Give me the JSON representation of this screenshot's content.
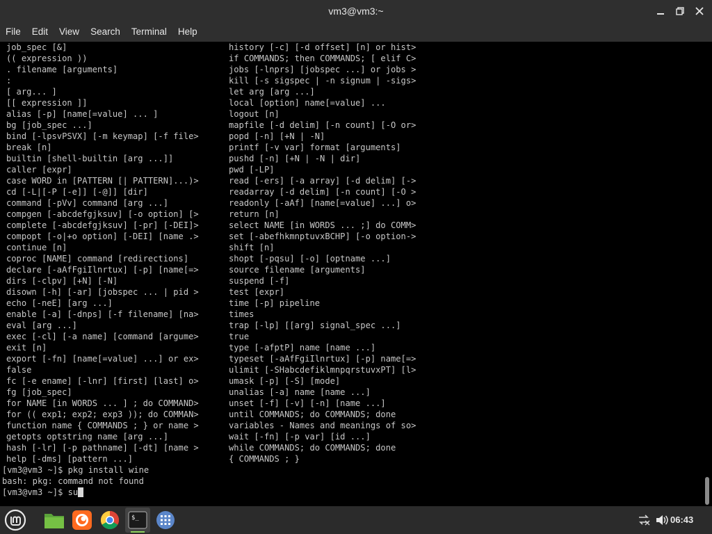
{
  "window": {
    "title": "vm3@vm3:~"
  },
  "menu": {
    "items": [
      "File",
      "Edit",
      "View",
      "Search",
      "Terminal",
      "Help"
    ]
  },
  "terminal": {
    "left_column": [
      "job_spec [&]",
      "(( expression ))",
      ". filename [arguments]",
      ":",
      "[ arg... ]",
      "[[ expression ]]",
      "alias [-p] [name[=value] ... ]",
      "bg [job_spec ...]",
      "bind [-lpsvPSVX] [-m keymap] [-f file>",
      "break [n]",
      "builtin [shell-builtin [arg ...]]",
      "caller [expr]",
      "case WORD in [PATTERN [| PATTERN]...)>",
      "cd [-L|[-P [-e]] [-@]] [dir]",
      "command [-pVv] command [arg ...]",
      "compgen [-abcdefgjksuv] [-o option] [>",
      "complete [-abcdefgjksuv] [-pr] [-DEI]>",
      "compopt [-o|+o option] [-DEI] [name .>",
      "continue [n]",
      "coproc [NAME] command [redirections]",
      "declare [-aAfFgiIlnrtux] [-p] [name[=>",
      "dirs [-clpv] [+N] [-N]",
      "disown [-h] [-ar] [jobspec ... | pid >",
      "echo [-neE] [arg ...]",
      "enable [-a] [-dnps] [-f filename] [na>",
      "eval [arg ...]",
      "exec [-cl] [-a name] [command [argume>",
      "exit [n]",
      "export [-fn] [name[=value] ...] or ex>",
      "false",
      "fc [-e ename] [-lnr] [first] [last] o>",
      "fg [job_spec]",
      "for NAME [in WORDS ... ] ; do COMMAND>",
      "for (( exp1; exp2; exp3 )); do COMMAN>",
      "function name { COMMANDS ; } or name >",
      "getopts optstring name [arg ...]",
      "hash [-lr] [-p pathname] [-dt] [name >",
      "help [-dms] [pattern ...]"
    ],
    "right_column": [
      "history [-c] [-d offset] [n] or hist>",
      "if COMMANDS; then COMMANDS; [ elif C>",
      "jobs [-lnprs] [jobspec ...] or jobs >",
      "kill [-s sigspec | -n signum | -sigs>",
      "let arg [arg ...]",
      "local [option] name[=value] ...",
      "logout [n]",
      "mapfile [-d delim] [-n count] [-O or>",
      "popd [-n] [+N | -N]",
      "printf [-v var] format [arguments]",
      "pushd [-n] [+N | -N | dir]",
      "pwd [-LP]",
      "read [-ers] [-a array] [-d delim] [->",
      "readarray [-d delim] [-n count] [-O >",
      "readonly [-aAf] [name[=value] ...] o>",
      "return [n]",
      "select NAME [in WORDS ... ;] do COMM>",
      "set [-abefhkmnptuvxBCHP] [-o option->",
      "shift [n]",
      "shopt [-pqsu] [-o] [optname ...]",
      "source filename [arguments]",
      "suspend [-f]",
      "test [expr]",
      "time [-p] pipeline",
      "times",
      "trap [-lp] [[arg] signal_spec ...]",
      "true",
      "type [-afptP] name [name ...]",
      "typeset [-aAfFgiIlnrtux] [-p] name[=>",
      "ulimit [-SHabcdefiklmnpqrstuvxPT] [l>",
      "umask [-p] [-S] [mode]",
      "unalias [-a] name [name ...]",
      "unset [-f] [-v] [-n] [name ...]",
      "until COMMANDS; do COMMANDS; done",
      "variables - Names and meanings of so>",
      "wait [-fn] [-p var] [id ...]",
      "while COMMANDS; do COMMANDS; done",
      "{ COMMANDS ; }"
    ],
    "session": [
      "[vm3@vm3 ~]$ pkg install wine",
      "bash: pkg: command not found",
      "[vm3@vm3 ~]$ su"
    ]
  },
  "taskbar": {
    "icons": [
      "mint-menu-icon",
      "files-icon",
      "firefox-icon",
      "chrome-icon",
      "terminal-icon",
      "app-grid-icon"
    ],
    "active": "terminal-icon",
    "clock": "06:43"
  },
  "colors": {
    "chrome_bg": "#2f2f2f",
    "terminal_bg": "#000000",
    "terminal_fg": "#c8c8c8",
    "taskbar_bg": "#2b2b2b",
    "accent": "#8fd35e"
  }
}
